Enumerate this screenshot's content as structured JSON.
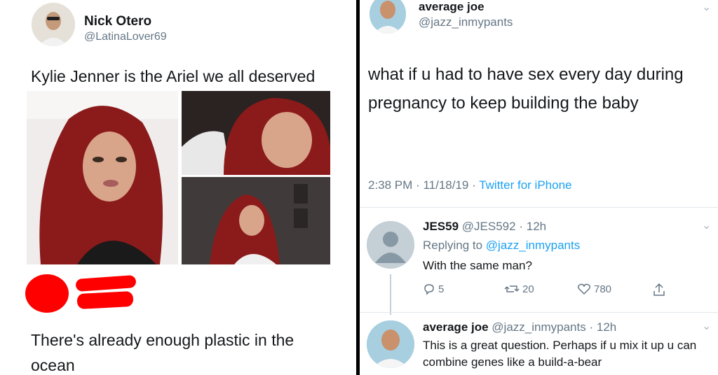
{
  "left_tweet": {
    "display_name": "Nick Otero",
    "handle": "@LatinaLover69",
    "text": "Kylie Jenner is the Ariel we all deserved",
    "reply_text": "There's already enough plastic in the ocean"
  },
  "right_tweet": {
    "display_name": "average joe",
    "handle": "@jazz_inmypants",
    "text": "what if u had to have sex every day during pregnancy to keep building the baby",
    "time": "2:38 PM",
    "date": "11/18/19",
    "source": "Twitter for iPhone"
  },
  "reply1": {
    "display_name": "JES59",
    "handle": "@JES592",
    "age": "12h",
    "replying_prefix": "Replying to",
    "replying_to": "@jazz_inmypants",
    "text": "With the same man?",
    "replies": "5",
    "retweets": "20",
    "likes": "780"
  },
  "reply2": {
    "display_name": "average joe",
    "handle": "@jazz_inmypants",
    "age": "12h",
    "text": "This is a great question. Perhaps if u mix it up u can combine genes like a build-a-bear"
  },
  "colors": {
    "link": "#1da1f2",
    "redaction": "#ff0000",
    "hair": "#8b1a1a",
    "divider": "#000000"
  }
}
